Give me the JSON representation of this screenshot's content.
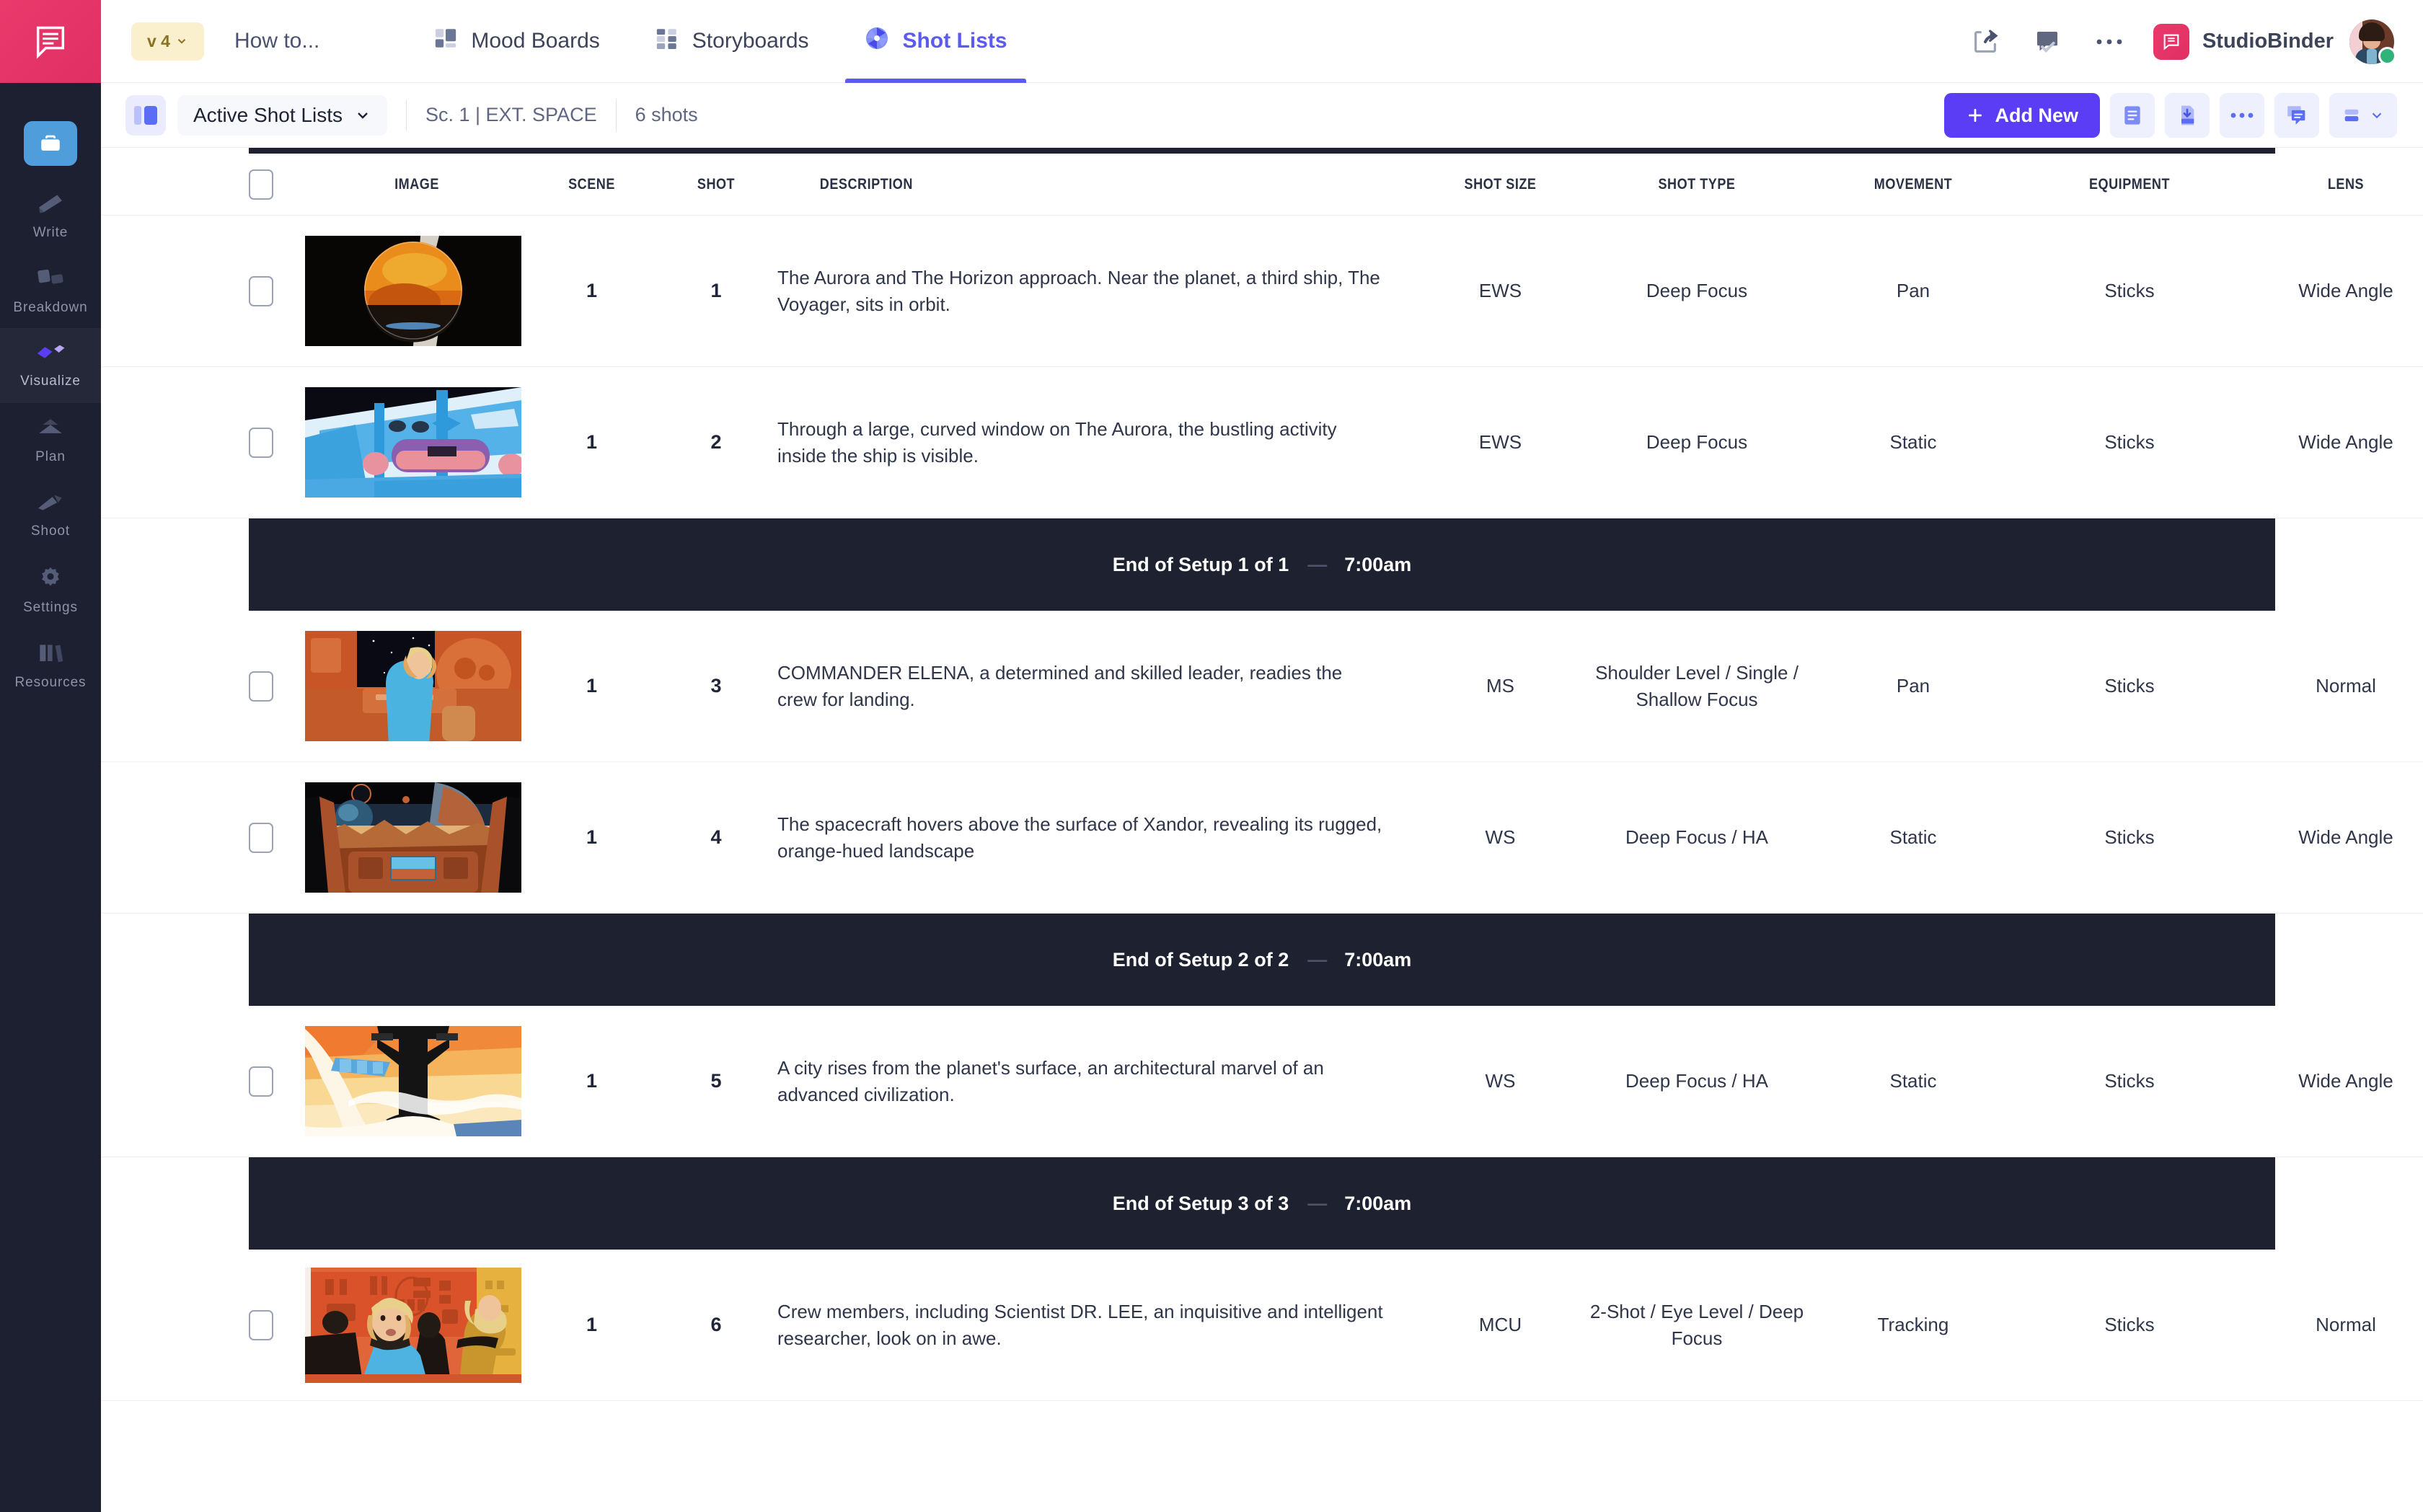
{
  "rail": {
    "logo_icon": "studiobinder-logo-icon",
    "items": [
      {
        "label": "",
        "icon": "briefcase-icon",
        "active": false
      },
      {
        "label": "Write",
        "icon": "write-icon",
        "active": false
      },
      {
        "label": "Breakdown",
        "icon": "breakdown-icon",
        "active": false
      },
      {
        "label": "Visualize",
        "icon": "visualize-icon",
        "active": true
      },
      {
        "label": "Plan",
        "icon": "plan-icon",
        "active": false
      },
      {
        "label": "Shoot",
        "icon": "shoot-icon",
        "active": false
      },
      {
        "label": "Settings",
        "icon": "gear-icon",
        "active": false
      },
      {
        "label": "Resources",
        "icon": "resources-icon",
        "active": false
      }
    ]
  },
  "topbar": {
    "version_label": "v 4",
    "project_title": "How to...",
    "tabs": [
      {
        "label": "Mood Boards",
        "icon": "mood-boards-icon",
        "active": false
      },
      {
        "label": "Storyboards",
        "icon": "storyboards-icon",
        "active": false
      },
      {
        "label": "Shot Lists",
        "icon": "aperture-icon",
        "active": true
      }
    ],
    "actions": [
      {
        "name": "share-icon"
      },
      {
        "name": "approval-icon"
      },
      {
        "name": "more-icon"
      }
    ],
    "brand_name": "StudioBinder",
    "user_status": "online"
  },
  "toolbar": {
    "panel_toggle_icon": "panel-toggle-icon",
    "list_selector": "Active Shot Lists",
    "scene_label": "Sc. 1 | EXT. SPACE",
    "shot_count": "6 shots",
    "add_new_label": "Add New",
    "actions": [
      {
        "name": "list-view-icon"
      },
      {
        "name": "pdf-download-icon"
      },
      {
        "name": "more-options-icon"
      },
      {
        "name": "comment-icon"
      },
      {
        "name": "layout-chooser-icon"
      }
    ]
  },
  "table": {
    "columns": [
      "IMAGE",
      "SCENE",
      "SHOT",
      "DESCRIPTION",
      "SHOT SIZE",
      "SHOT TYPE",
      "MOVEMENT",
      "EQUIPMENT",
      "LENS"
    ],
    "rows": [
      {
        "kind": "shot",
        "image": "planet-xandor-orbit-thumbnail",
        "scene": "1",
        "shot": "1",
        "description": "The Aurora and The Horizon approach. Near the planet, a third ship, The Voyager, sits in orbit.",
        "shot_size": "EWS",
        "shot_type": "Deep Focus",
        "movement": "Pan",
        "equipment": "Sticks",
        "lens": "Wide Angle"
      },
      {
        "kind": "shot",
        "image": "aurora-ship-window-thumbnail",
        "scene": "1",
        "shot": "2",
        "description": "Through a large, curved window on The Aurora, the bustling activity inside the ship is visible.",
        "shot_size": "EWS",
        "shot_type": "Deep Focus",
        "movement": "Static",
        "equipment": "Sticks",
        "lens": "Wide Angle"
      },
      {
        "kind": "setup",
        "label": "End of  Setup 1 of 1",
        "dash": "—",
        "time": "7:00am"
      },
      {
        "kind": "shot",
        "image": "commander-elena-thumbnail",
        "scene": "1",
        "shot": "3",
        "description": "COMMANDER ELENA, a determined and skilled leader, readies the crew for landing.",
        "shot_size": "MS",
        "shot_type": "Shoulder Level / Single / Shallow Focus",
        "movement": "Pan",
        "equipment": "Sticks",
        "lens": "Normal"
      },
      {
        "kind": "shot",
        "image": "cockpit-xandor-surface-thumbnail",
        "scene": "1",
        "shot": "4",
        "description": "The spacecraft hovers above the surface of Xandor, revealing its rugged, orange-hued landscape",
        "shot_size": "WS",
        "shot_type": "Deep Focus / HA",
        "movement": "Static",
        "equipment": "Sticks",
        "lens": "Wide Angle"
      },
      {
        "kind": "setup",
        "label": "End of  Setup 2 of 2",
        "dash": "—",
        "time": "7:00am"
      },
      {
        "kind": "shot",
        "image": "alien-city-tower-thumbnail",
        "scene": "1",
        "shot": "5",
        "description": "A city rises from the planet's surface, an architectural marvel of an advanced civilization.",
        "shot_size": "WS",
        "shot_type": "Deep Focus / HA",
        "movement": "Static",
        "equipment": "Sticks",
        "lens": "Wide Angle"
      },
      {
        "kind": "setup",
        "label": "End of  Setup 3 of 3",
        "dash": "—",
        "time": "7:00am"
      },
      {
        "kind": "shot",
        "image": "crew-dr-lee-thumbnail",
        "scene": "1",
        "shot": "6",
        "description": "Crew members, including Scientist DR. LEE, an inquisitive and intelligent researcher, look on in awe.",
        "shot_size": "MCU",
        "shot_type": "2-Shot / Eye Level / Deep Focus",
        "movement": "Tracking",
        "equipment": "Sticks",
        "lens": "Normal"
      }
    ]
  },
  "colors": {
    "accent": "#5b3df5",
    "brand": "#e02f63",
    "rail_bg": "#1c2030",
    "setup_bar": "#1d2130",
    "tab_active": "#5b5bf0",
    "badge_bg": "#faf0cd",
    "status_online": "#2fb37a"
  }
}
